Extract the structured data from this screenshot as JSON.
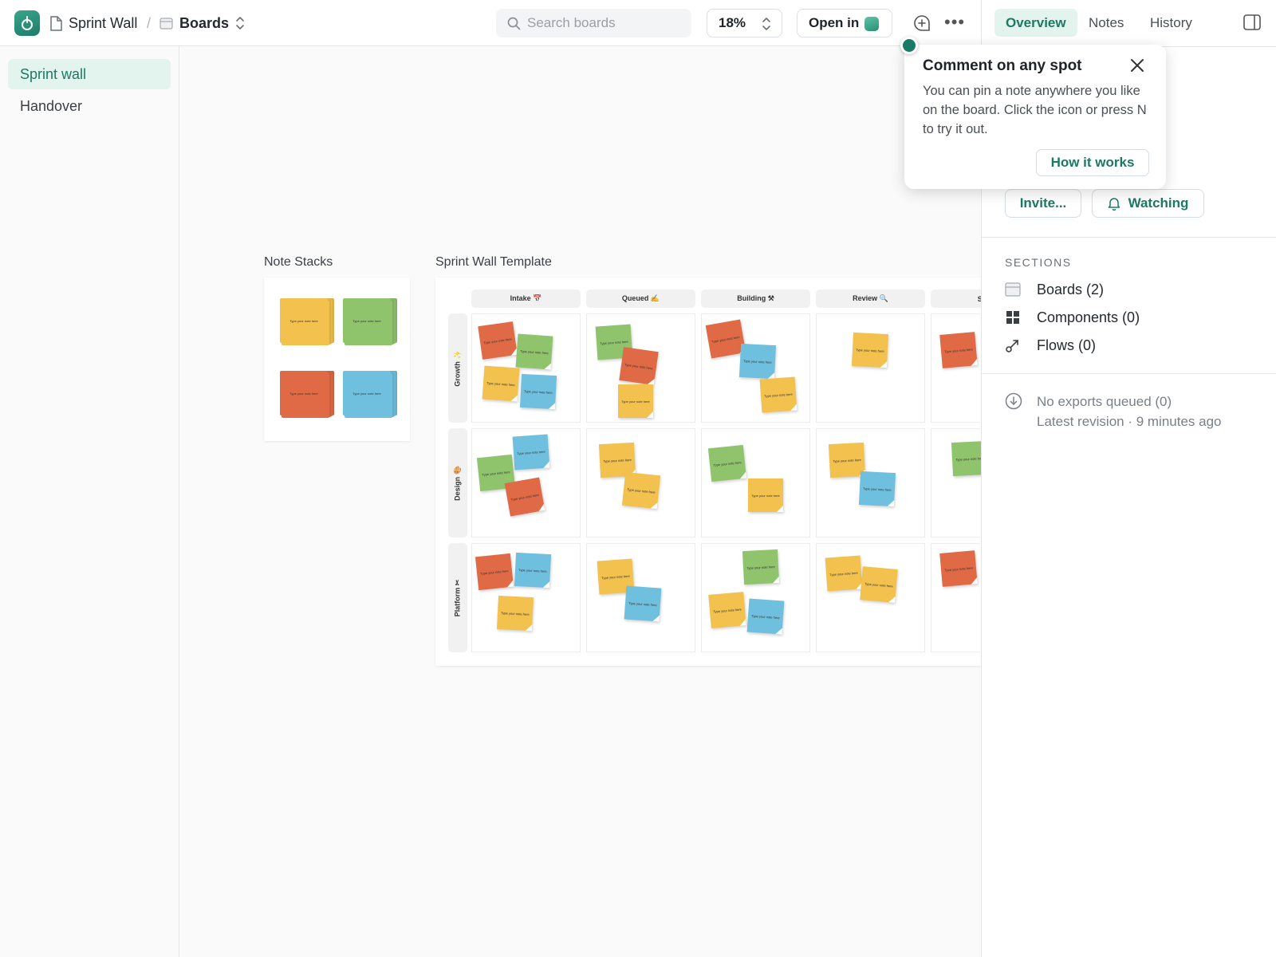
{
  "header": {
    "project_name": "Sprint Wall",
    "separator": "/",
    "section_name": "Boards",
    "search_placeholder": "Search boards",
    "zoom_level": "18%",
    "open_in_label": "Open in"
  },
  "sidebar": {
    "items": [
      {
        "label": "Sprint wall",
        "active": true
      },
      {
        "label": "Handover",
        "active": false
      }
    ]
  },
  "canvas": {
    "note_stacks_label": "Note Stacks",
    "template_label": "Sprint Wall Template",
    "note_text": "Type your note here",
    "columns": [
      "Intake 📅",
      "Queued ✍",
      "Building ⚒",
      "Review 🔍",
      "Ship"
    ],
    "rows": [
      "Growth ✨",
      "Design 🎨",
      "Platform ✂"
    ]
  },
  "right_panel": {
    "tabs": [
      {
        "label": "Overview",
        "active": true
      },
      {
        "label": "Notes",
        "active": false
      },
      {
        "label": "History",
        "active": false
      }
    ],
    "invite_label": "Invite...",
    "watching_label": "Watching",
    "sections_title": "SECTIONS",
    "sections": [
      {
        "label": "Boards (2)",
        "icon": "board-icon"
      },
      {
        "label": "Components (0)",
        "icon": "grid-icon"
      },
      {
        "label": "Flows (0)",
        "icon": "flow-icon"
      }
    ],
    "exports_text": "No exports queued (0)",
    "revision_text": "Latest revision · 9 minutes ago"
  },
  "popover": {
    "title": "Comment on any spot",
    "body": "You can pin a note anywhere you like on the board. Click the icon or press N to try it out.",
    "button_label": "How it works"
  },
  "colors": {
    "accent": "#1b7a63",
    "accent_bg": "#e3f3ee",
    "note_yellow": "#f2c14e",
    "note_green": "#8fc46d",
    "note_red": "#e06a45",
    "note_blue": "#6fc0df"
  }
}
